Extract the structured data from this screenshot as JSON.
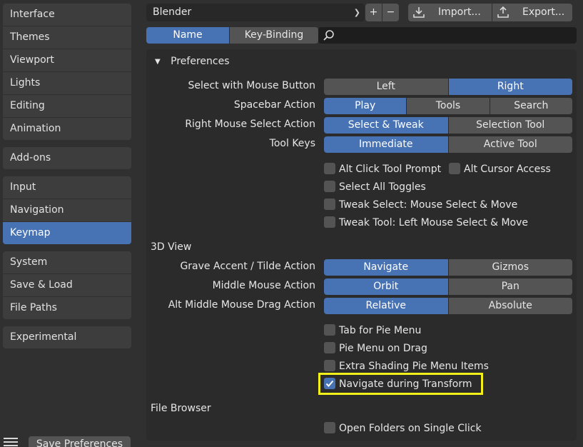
{
  "sidebar": {
    "groups": [
      [
        "Interface",
        "Themes",
        "Viewport",
        "Lights",
        "Editing",
        "Animation"
      ],
      [
        "Add-ons"
      ],
      [
        "Input",
        "Navigation",
        "Keymap"
      ],
      [
        "System",
        "Save & Load",
        "File Paths"
      ],
      [
        "Experimental"
      ]
    ],
    "active": "Keymap",
    "save_label": "Save Preferences"
  },
  "header": {
    "preset": "Blender",
    "import_label": "Import...",
    "export_label": "Export...",
    "plus": "+",
    "minus": "−"
  },
  "tabs": {
    "name": "Name",
    "keybinding": "Key-Binding"
  },
  "preferences": {
    "title": "Preferences",
    "rows": [
      {
        "label": "Select with Mouse Button",
        "options": [
          "Left",
          "Right"
        ],
        "selected": "Right"
      },
      {
        "label": "Spacebar Action",
        "options": [
          "Play",
          "Tools",
          "Search"
        ],
        "selected": "Play"
      },
      {
        "label": "Right Mouse Select Action",
        "options": [
          "Select & Tweak",
          "Selection Tool"
        ],
        "selected": "Select & Tweak"
      },
      {
        "label": "Tool Keys",
        "options": [
          "Immediate",
          "Active Tool"
        ],
        "selected": "Immediate"
      }
    ],
    "checkboxes": [
      {
        "label": "Alt Click Tool Prompt",
        "checked": false
      },
      {
        "label": "Alt Cursor Access",
        "checked": false
      },
      {
        "label": "Select All Toggles",
        "checked": false
      },
      {
        "label": "Tweak Select: Mouse Select & Move",
        "checked": false
      },
      {
        "label": "Tweak Tool: Left Mouse Select & Move",
        "checked": false
      }
    ]
  },
  "view3d": {
    "title": "3D View",
    "rows": [
      {
        "label": "Grave Accent / Tilde Action",
        "options": [
          "Navigate",
          "Gizmos"
        ],
        "selected": "Navigate"
      },
      {
        "label": "Middle Mouse Action",
        "options": [
          "Orbit",
          "Pan"
        ],
        "selected": "Orbit"
      },
      {
        "label": "Alt Middle Mouse Drag Action",
        "options": [
          "Relative",
          "Absolute"
        ],
        "selected": "Relative"
      }
    ],
    "checkboxes": [
      {
        "label": "Tab for Pie Menu",
        "checked": false
      },
      {
        "label": "Pie Menu on Drag",
        "checked": false
      },
      {
        "label": "Extra Shading Pie Menu Items",
        "checked": false
      },
      {
        "label": "Navigate during Transform",
        "checked": true
      }
    ]
  },
  "file_browser": {
    "title": "File Browser",
    "checkboxes": [
      {
        "label": "Open Folders on Single Click",
        "checked": false
      }
    ]
  },
  "colors": {
    "accent": "#4772b3",
    "highlight": "#f2ef1b"
  }
}
